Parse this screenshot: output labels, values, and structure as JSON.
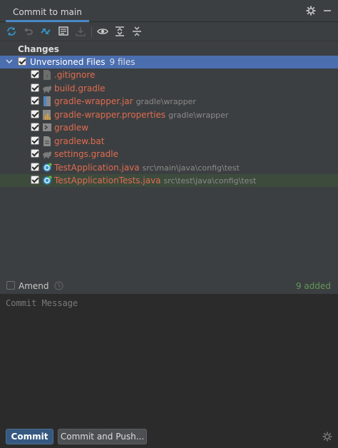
{
  "header": {
    "tab_label": "Commit to main"
  },
  "toolbar": {
    "buttons": [
      {
        "icon": "refresh-icon"
      },
      {
        "icon": "rollback-icon"
      },
      {
        "icon": "diff-icon"
      },
      {
        "icon": "shelve-icon"
      },
      {
        "icon": "update-icon"
      },
      {
        "icon": "eye-icon"
      },
      {
        "icon": "expand-all-icon"
      },
      {
        "icon": "collapse-all-icon"
      }
    ]
  },
  "changes": {
    "section_title": "Changes",
    "group": {
      "label": "Unversioned Files",
      "count": "9 files",
      "checked": true
    },
    "files": [
      {
        "name": ".gitignore",
        "path": "",
        "icon": "gitignore-icon",
        "checked": true
      },
      {
        "name": "build.gradle",
        "path": "",
        "icon": "gradle-icon",
        "checked": true
      },
      {
        "name": "gradle-wrapper.jar",
        "path": "gradle\\wrapper",
        "icon": "jar-icon",
        "checked": true
      },
      {
        "name": "gradle-wrapper.properties",
        "path": "gradle\\wrapper",
        "icon": "properties-icon",
        "checked": true
      },
      {
        "name": "gradlew",
        "path": "",
        "icon": "script-icon",
        "checked": true
      },
      {
        "name": "gradlew.bat",
        "path": "",
        "icon": "bat-file-icon",
        "checked": true
      },
      {
        "name": "settings.gradle",
        "path": "",
        "icon": "gradle-icon",
        "checked": true
      },
      {
        "name": "TestApplication.java",
        "path": "src\\main\\java\\config\\test",
        "icon": "java-class-icon",
        "checked": true
      },
      {
        "name": "TestApplicationTests.java",
        "path": "src\\test\\java\\config\\test",
        "icon": "java-test-class-icon",
        "checked": true
      }
    ]
  },
  "amend": {
    "label": "Amend",
    "checked": false,
    "status": "9 added"
  },
  "commit_message": {
    "value": "",
    "placeholder": "Commit Message"
  },
  "actions": {
    "commit_label": "Commit",
    "commit_push_label": "Commit and Push..."
  },
  "colors": {
    "accent": "#4a88c7",
    "selection": "#4b6eaf",
    "unversioned_text": "#e06c50",
    "added_status": "#629755",
    "primary_button": "#365880"
  }
}
